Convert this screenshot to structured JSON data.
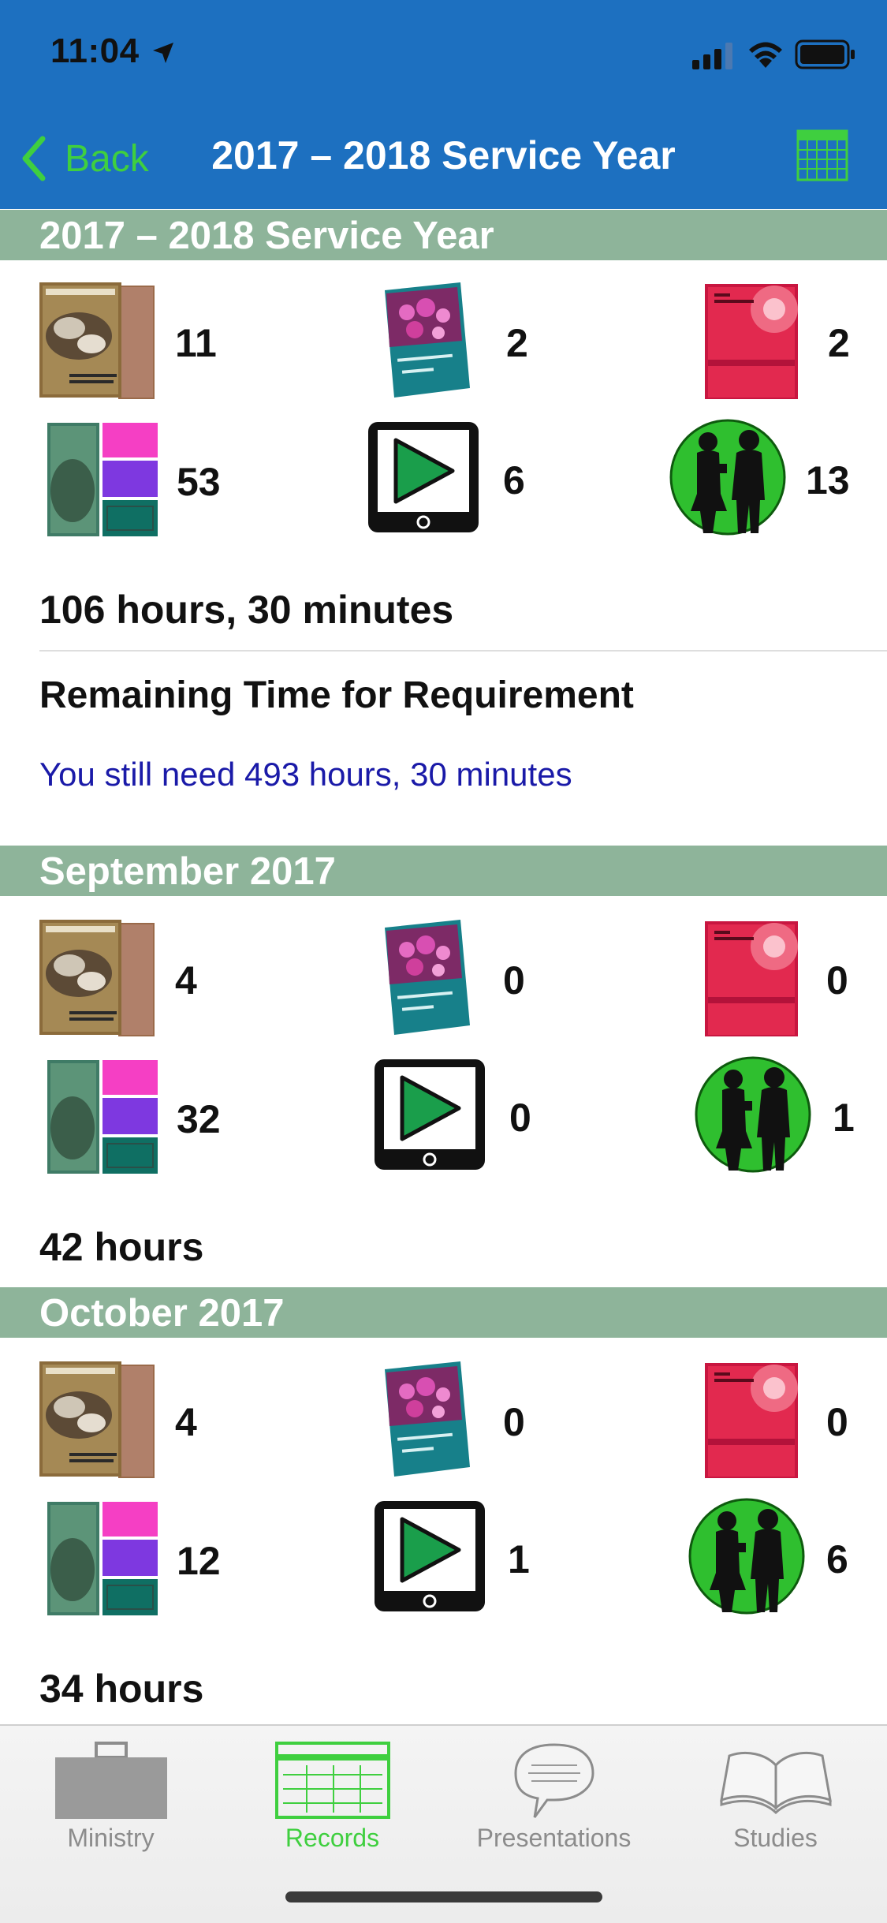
{
  "status": {
    "time": "11:04"
  },
  "nav": {
    "back_label": "Back",
    "title": "2017 – 2018 Service Year"
  },
  "colors": {
    "nav_bg": "#1d70c0",
    "accent": "#3fcf3f",
    "section_bg": "#8eb49a",
    "link_text": "#1a1aa8"
  },
  "year": {
    "header": "2017 – 2018 Service Year",
    "stats": {
      "brochures": "11",
      "magazine": "2",
      "book": "2",
      "tracts": "53",
      "videos": "6",
      "return_visits": "13"
    },
    "hours": "106 hours, 30 minutes",
    "requirement_title": "Remaining Time for Requirement",
    "requirement_note": "You still need 493 hours, 30 minutes"
  },
  "september": {
    "header": "September 2017",
    "stats": {
      "brochures": "4",
      "magazine": "0",
      "book": "0",
      "tracts": "32",
      "videos": "0",
      "return_visits": "1"
    },
    "hours": "42 hours"
  },
  "october": {
    "header": "October 2017",
    "stats": {
      "brochures": "4",
      "magazine": "0",
      "book": "0",
      "tracts": "12",
      "videos": "1",
      "return_visits": "6"
    },
    "hours": "34 hours"
  },
  "tabs": [
    {
      "label": "Ministry",
      "icon": "briefcase-icon"
    },
    {
      "label": "Records",
      "icon": "records-icon"
    },
    {
      "label": "Presentations",
      "icon": "speech-bubble-icon"
    },
    {
      "label": "Studies",
      "icon": "open-book-icon"
    }
  ]
}
